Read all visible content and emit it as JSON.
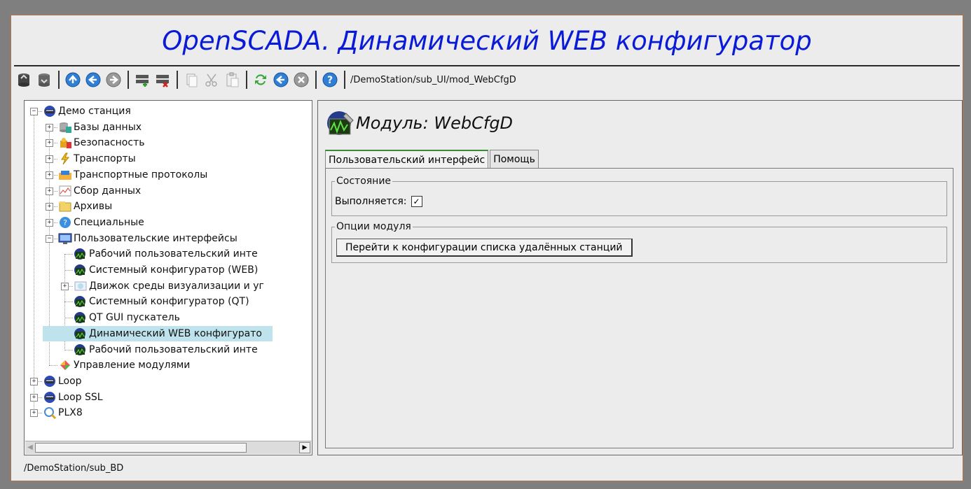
{
  "app": {
    "title": "OpenSCADA. Динамический WEB конфигуратор",
    "path": "/DemoStation/sub_UI/mod_WebCfgD",
    "status": "/DemoStation/sub_BD"
  },
  "toolbar": {
    "icons": [
      "db-load-icon",
      "db-save-icon",
      "up-icon",
      "back-icon",
      "forward-icon",
      "add-item-icon",
      "delete-item-icon",
      "copy-icon",
      "cut-icon",
      "paste-icon",
      "refresh-icon",
      "start-icon",
      "stop-icon",
      "help-icon"
    ]
  },
  "tree": {
    "items": [
      {
        "label": "Демо станция"
      },
      {
        "label": "Базы данных"
      },
      {
        "label": "Безопасность"
      },
      {
        "label": "Транспорты"
      },
      {
        "label": "Транспортные протоколы"
      },
      {
        "label": "Сбор данных"
      },
      {
        "label": "Архивы"
      },
      {
        "label": "Специальные"
      },
      {
        "label": "Пользовательские интерфейсы"
      },
      {
        "label": "Рабочий пользовательский инте"
      },
      {
        "label": "Системный конфигуратор (WEB)"
      },
      {
        "label": "Движок среды визуализации и уг"
      },
      {
        "label": "Системный конфигуратор (QT)"
      },
      {
        "label": "QT GUI пускатель"
      },
      {
        "label": "Динамический WEB конфигурато"
      },
      {
        "label": "Рабочий пользовательский инте"
      },
      {
        "label": "Управление модулями"
      },
      {
        "label": "Loop"
      },
      {
        "label": "Loop SSL"
      },
      {
        "label": "PLX8"
      }
    ],
    "selected_index": 14
  },
  "main": {
    "title": "Модуль: WebCfgD",
    "tabs": [
      {
        "label": "Пользовательский интерфейс",
        "active": true
      },
      {
        "label": "Помощь",
        "active": false
      }
    ],
    "state_group": {
      "legend": "Состояние",
      "running_label": "Выполняется:",
      "running": true,
      "check_mark": "✓"
    },
    "options_group": {
      "legend": "Опции модуля",
      "button_label": "Перейти к конфигурации списка удалённых станций"
    }
  },
  "colors": {
    "title": "#0a1bd8",
    "selection": "#bfe3ec",
    "window_border": "#9a7a62"
  }
}
